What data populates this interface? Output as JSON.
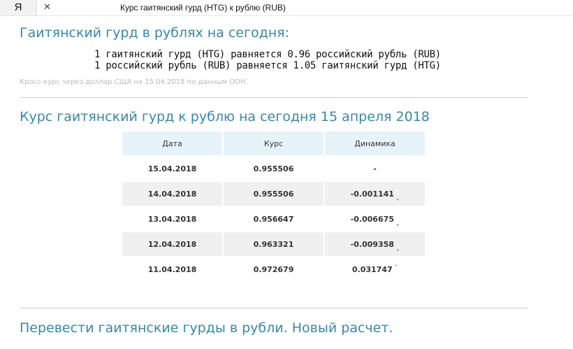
{
  "browser": {
    "home_label": "Я",
    "close_glyph": "✕",
    "tab_title": "Курс гаитянский гурд (HTG) к рублю (RUB)"
  },
  "converter": {
    "title": "Гаитянский гурд в рублях на сегодня:",
    "line1": "1 гаитянский гурд (HTG) равняется 0.96 российский рубль (RUB)",
    "line2": "1 российский рубль (RUB) равняется 1.05 гаитянский гурд (HTG)",
    "note": "Кросс-курс через доллар США на 15.04.2018 по данным ООН."
  },
  "rates": {
    "title": "Курс гаитянский гурд к рублю на сегодня 15 апреля 2018",
    "columns": [
      "Дата",
      "Курс",
      "Динамика"
    ],
    "rows": [
      {
        "date": "15.04.2018",
        "rate": "0.955506",
        "change": "-",
        "trend": "none"
      },
      {
        "date": "14.04.2018",
        "rate": "0.955506",
        "change": "-0.001141",
        "trend": "down"
      },
      {
        "date": "13.04.2018",
        "rate": "0.956647",
        "change": "-0.006675",
        "trend": "down"
      },
      {
        "date": "12.04.2018",
        "rate": "0.963321",
        "change": "-0.009358",
        "trend": "down"
      },
      {
        "date": "11.04.2018",
        "rate": "0.972679",
        "change": "0.031747",
        "trend": "up"
      }
    ]
  },
  "recalc": {
    "title": "Перевести гаитянские гурды в рубли. Новый расчет."
  },
  "colors": {
    "heading": "#3a87a8",
    "header_row": "#e6f3fa",
    "shaded_row": "#f0f0f0",
    "trend_down": "#d62b2b",
    "trend_up": "#4aa04a"
  }
}
